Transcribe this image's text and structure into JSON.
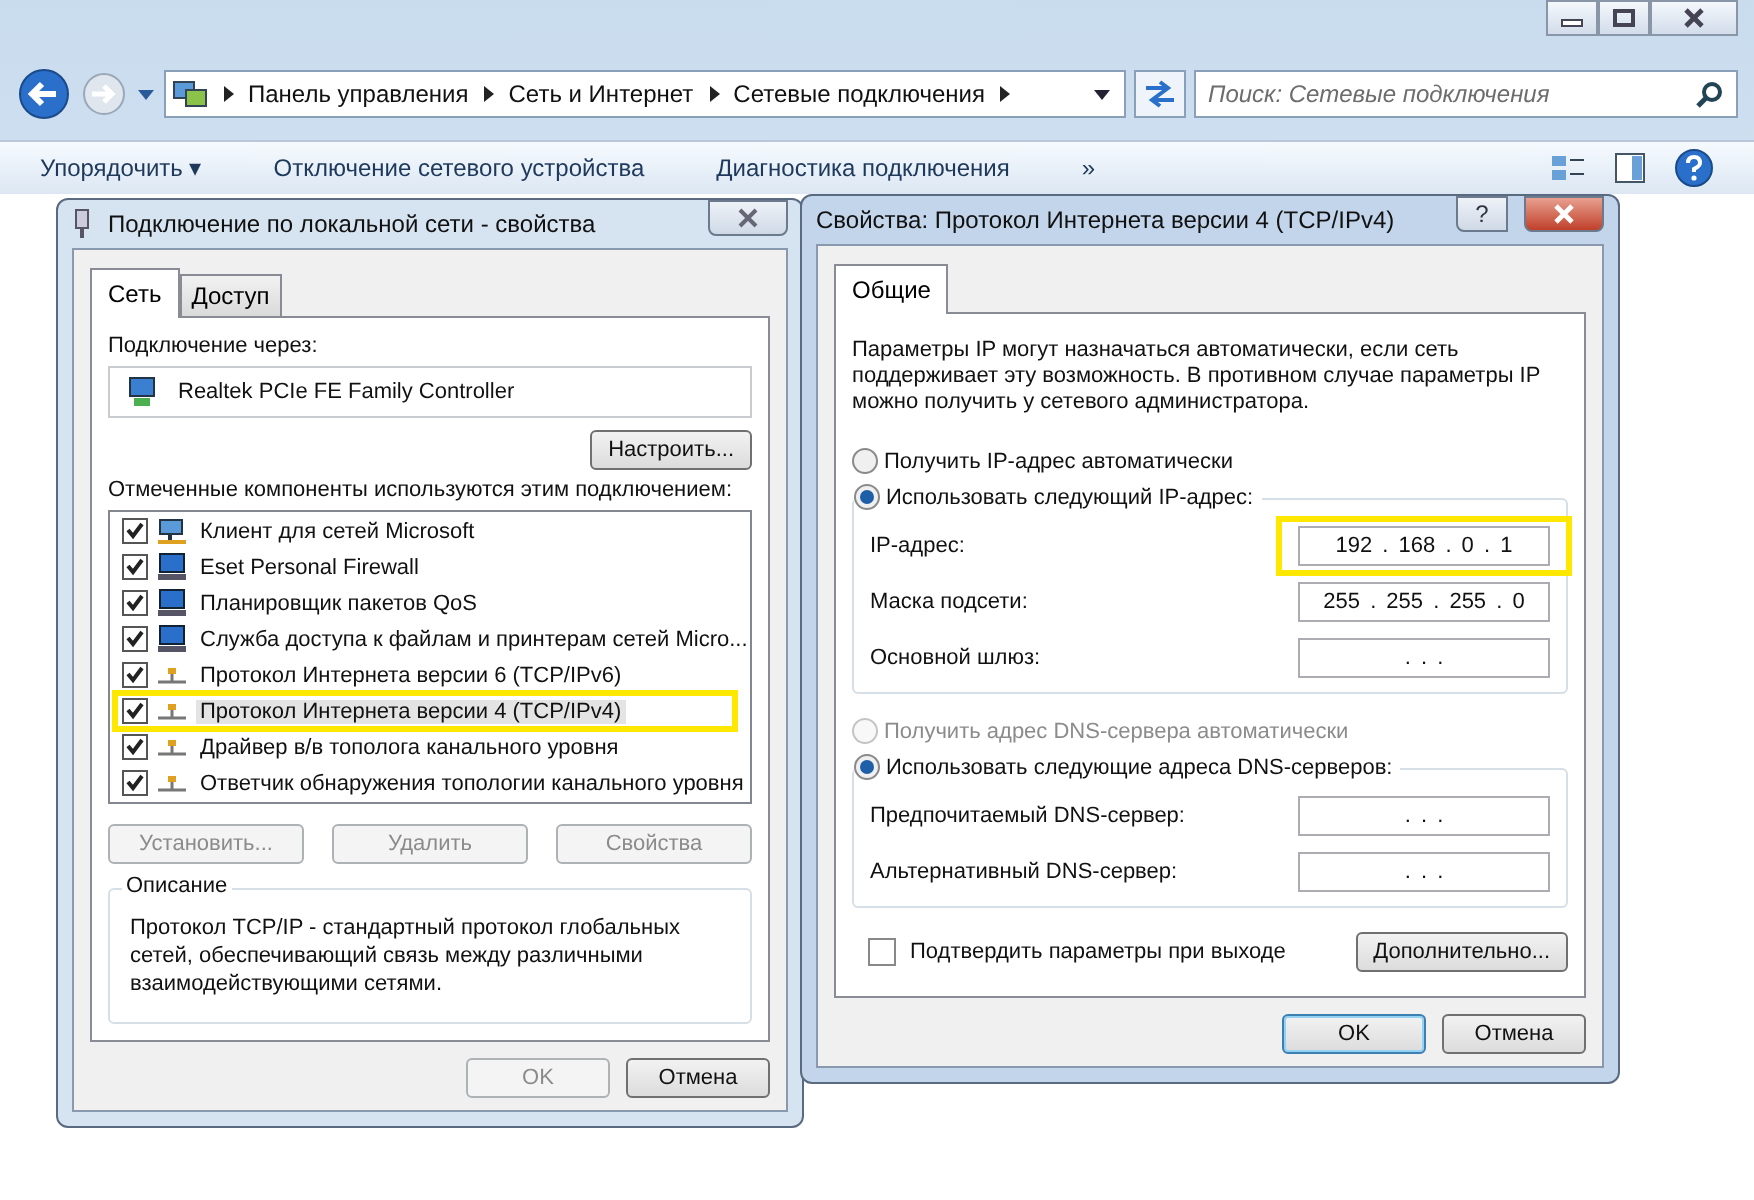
{
  "explorer": {
    "breadcrumb": [
      "Панель управления",
      "Сеть и Интернет",
      "Сетевые подключения"
    ],
    "search": {
      "placeholder": "Поиск: Сетевые подключения"
    },
    "toolbar": [
      "Упорядочить ▾",
      "Отключение сетевого устройства",
      "Диагностика подключения",
      "»"
    ]
  },
  "lan_dialog": {
    "title": "Подключение по локальной сети - свойства",
    "tabs": [
      {
        "label": "Сеть",
        "selected": true
      },
      {
        "label": "Доступ",
        "selected": false
      }
    ],
    "connect_via_label": "Подключение через:",
    "adapter": "Realtek PCIe FE Family Controller",
    "configure_button": "Настроить...",
    "components_label": "Отмеченные компоненты используются этим подключением:",
    "components": [
      {
        "label": "Клиент для сетей Microsoft",
        "kind": "client",
        "checked": true,
        "selected": false,
        "highlighted": false
      },
      {
        "label": "Eset Personal Firewall",
        "kind": "service",
        "checked": true,
        "selected": false,
        "highlighted": false
      },
      {
        "label": "Планировщик пакетов QoS",
        "kind": "service",
        "checked": true,
        "selected": false,
        "highlighted": false
      },
      {
        "label": "Служба доступа к файлам и принтерам сетей Micro...",
        "kind": "service",
        "checked": true,
        "selected": false,
        "highlighted": false
      },
      {
        "label": "Протокол Интернета версии 6 (TCP/IPv6)",
        "kind": "protocol",
        "checked": true,
        "selected": false,
        "highlighted": false
      },
      {
        "label": "Протокол Интернета версии 4 (TCP/IPv4)",
        "kind": "protocol",
        "checked": true,
        "selected": true,
        "highlighted": true
      },
      {
        "label": "Драйвер в/в тополога канального уровня",
        "kind": "protocol",
        "checked": true,
        "selected": false,
        "highlighted": false
      },
      {
        "label": "Ответчик обнаружения топологии канального уровня",
        "kind": "protocol",
        "checked": true,
        "selected": false,
        "highlighted": false
      }
    ],
    "component_buttons": [
      {
        "label": "Установить...",
        "disabled": true
      },
      {
        "label": "Удалить",
        "disabled": true
      },
      {
        "label": "Свойства",
        "disabled": true
      }
    ],
    "description": {
      "legend": "Описание",
      "text": "Протокол TCP/IP - стандартный протокол глобальных сетей, обеспечивающий связь между различными взаимодействующими сетями."
    },
    "footer_buttons": [
      {
        "label": "OK",
        "disabled": true
      },
      {
        "label": "Отмена",
        "disabled": false
      }
    ]
  },
  "ipv4_dialog": {
    "title": "Свойства: Протокол Интернета версии 4 (TCP/IPv4)",
    "help_button": "?",
    "tabs": [
      {
        "label": "Общие",
        "selected": true
      }
    ],
    "intro": "Параметры IP могут назначаться автоматически, если сеть поддерживает эту возможность. В противном случае параметры IP можно получить у сетевого администратора.",
    "ip_options": [
      {
        "label": "Получить IP-адрес автоматически",
        "selected": false,
        "disabled": false
      },
      {
        "label": "Использовать следующий IP-адрес:",
        "selected": true,
        "disabled": false
      }
    ],
    "ip_fields": [
      {
        "label": "IP-адрес:",
        "value": "192 . 168 . 0 . 1",
        "highlighted": true
      },
      {
        "label": "Маска подсети:",
        "value": "255 . 255 . 255 . 0",
        "highlighted": false
      },
      {
        "label": "Основной шлюз:",
        "value": ". . .",
        "highlighted": false
      }
    ],
    "dns_options": [
      {
        "label": "Получить адрес DNS-сервера автоматически",
        "selected": false,
        "disabled": true
      },
      {
        "label": "Использовать следующие адреса DNS-серверов:",
        "selected": true,
        "disabled": false
      }
    ],
    "dns_fields": [
      {
        "label": "Предпочитаемый DNS-сервер:",
        "value": ". . .",
        "highlighted": false
      },
      {
        "label": "Альтернативный DNS-сервер:",
        "value": ". . .",
        "highlighted": false
      }
    ],
    "validate": {
      "label": "Подтвердить параметры при выходе",
      "checked": false
    },
    "advanced_button": "Дополнительно...",
    "footer_buttons": [
      {
        "label": "OK",
        "default": true
      },
      {
        "label": "Отмена",
        "default": false
      }
    ]
  }
}
